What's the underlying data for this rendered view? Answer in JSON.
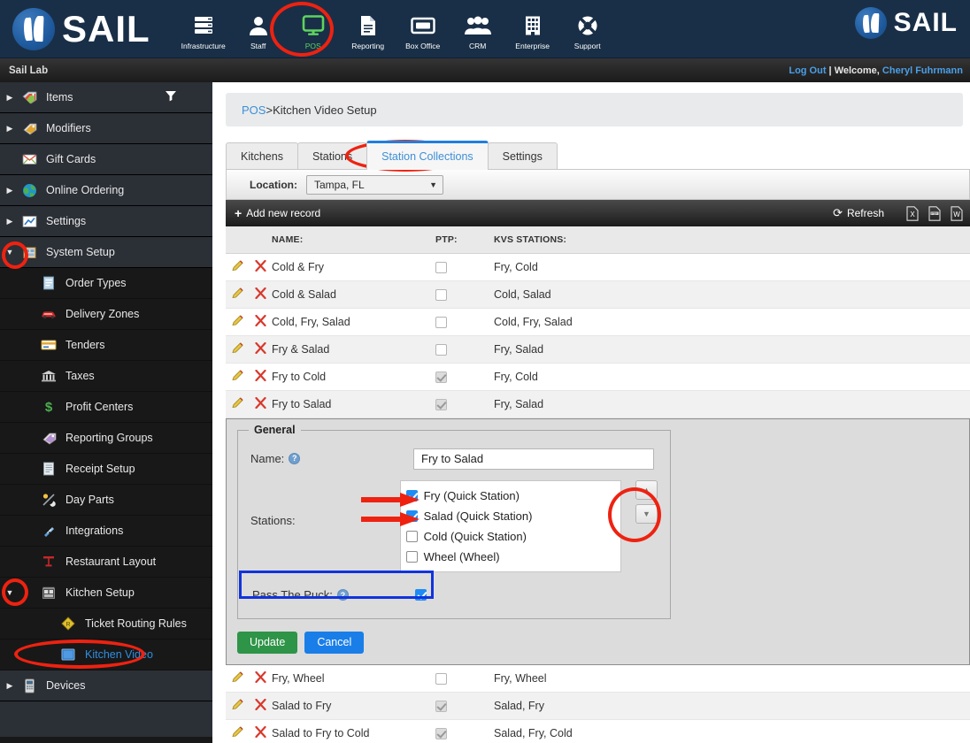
{
  "header": {
    "brand": "SAIL",
    "nav": [
      {
        "label": "Infrastructure",
        "icon": "server-icon",
        "active": false
      },
      {
        "label": "Staff",
        "icon": "user-icon",
        "active": false
      },
      {
        "label": "POS",
        "icon": "monitor-icon",
        "active": true
      },
      {
        "label": "Reporting",
        "icon": "document-icon",
        "active": false
      },
      {
        "label": "Box Office",
        "icon": "ticket-icon",
        "active": false
      },
      {
        "label": "CRM",
        "icon": "people-icon",
        "active": false
      },
      {
        "label": "Enterprise",
        "icon": "building-icon",
        "active": false
      },
      {
        "label": "Support",
        "icon": "lifering-icon",
        "active": false
      }
    ]
  },
  "subbar": {
    "site": "Sail Lab",
    "logout": "Log Out",
    "separator": " | ",
    "welcome": "Welcome, ",
    "user": "Cheryl Fuhrmann"
  },
  "sidebar": {
    "items": [
      {
        "label": "Items",
        "icon": "tags-icon",
        "level": 1,
        "caret": "right",
        "filter": true,
        "selected": false
      },
      {
        "label": "Modifiers",
        "icon": "tag-icon",
        "level": 1,
        "caret": "right",
        "filter": false,
        "selected": false
      },
      {
        "label": "Gift Cards",
        "icon": "giftcard-icon",
        "level": 1,
        "caret": "none",
        "filter": false,
        "selected": false
      },
      {
        "label": "Online Ordering",
        "icon": "globe-icon",
        "level": 1,
        "caret": "right",
        "filter": false,
        "selected": false
      },
      {
        "label": "Settings",
        "icon": "chart-icon",
        "level": 1,
        "caret": "right",
        "filter": false,
        "selected": false
      },
      {
        "label": "System Setup",
        "icon": "setup-icon",
        "level": 1,
        "caret": "down",
        "filter": false,
        "selected": false
      },
      {
        "label": "Order Types",
        "icon": "list-icon",
        "level": 2,
        "caret": "none",
        "filter": false,
        "selected": false
      },
      {
        "label": "Delivery Zones",
        "icon": "car-icon",
        "level": 2,
        "caret": "none",
        "filter": false,
        "selected": false
      },
      {
        "label": "Tenders",
        "icon": "creditcard-icon",
        "level": 2,
        "caret": "none",
        "filter": false,
        "selected": false
      },
      {
        "label": "Taxes",
        "icon": "bank-icon",
        "level": 2,
        "caret": "none",
        "filter": false,
        "selected": false
      },
      {
        "label": "Profit Centers",
        "icon": "dollar-icon",
        "level": 2,
        "caret": "none",
        "filter": false,
        "selected": false
      },
      {
        "label": "Reporting Groups",
        "icon": "tag-icon",
        "level": 2,
        "caret": "none",
        "filter": false,
        "selected": false
      },
      {
        "label": "Receipt Setup",
        "icon": "receipt-icon",
        "level": 2,
        "caret": "none",
        "filter": false,
        "selected": false
      },
      {
        "label": "Day Parts",
        "icon": "daynight-icon",
        "level": 2,
        "caret": "none",
        "filter": false,
        "selected": false
      },
      {
        "label": "Integrations",
        "icon": "plug-icon",
        "level": 2,
        "caret": "none",
        "filter": false,
        "selected": false
      },
      {
        "label": "Restaurant Layout",
        "icon": "table-icon",
        "level": 2,
        "caret": "none",
        "filter": false,
        "selected": false
      },
      {
        "label": "Kitchen Setup",
        "icon": "kitchen-icon",
        "level": 2,
        "caret": "down",
        "filter": false,
        "selected": false
      },
      {
        "label": "Ticket Routing Rules",
        "icon": "routing-icon",
        "level": 3,
        "caret": "none",
        "filter": false,
        "selected": false
      },
      {
        "label": "Kitchen Video",
        "icon": "video-icon",
        "level": 3,
        "caret": "none",
        "filter": false,
        "selected": true
      },
      {
        "label": "Devices",
        "icon": "device-icon",
        "level": 1,
        "caret": "right",
        "filter": false,
        "selected": false
      }
    ]
  },
  "breadcrumb": {
    "root": "POS",
    "sep": " > ",
    "current": "Kitchen Video Setup"
  },
  "tabs": [
    {
      "label": "Kitchens",
      "active": false
    },
    {
      "label": "Stations",
      "active": false
    },
    {
      "label": "Station Collections",
      "active": true
    },
    {
      "label": "Settings",
      "active": false
    }
  ],
  "location": {
    "label": "Location:",
    "value": "Tampa, FL",
    "options": [
      "Tampa, FL"
    ]
  },
  "gridbar": {
    "add_label": "Add new record",
    "refresh_label": "Refresh",
    "exports": [
      {
        "name": "excel-export-icon",
        "glyph": "X"
      },
      {
        "name": "pdf-export-icon",
        "glyph": "PDF"
      },
      {
        "name": "word-export-icon",
        "glyph": "W"
      }
    ]
  },
  "table": {
    "columns": [
      "",
      "",
      "NAME:",
      "PTP:",
      "KVS STATIONS:"
    ],
    "rows_top": [
      {
        "name": "Cold & Fry",
        "ptp": false,
        "stations": "Fry, Cold"
      },
      {
        "name": "Cold & Salad",
        "ptp": false,
        "stations": "Cold, Salad"
      },
      {
        "name": "Cold, Fry, Salad",
        "ptp": false,
        "stations": "Cold, Fry, Salad"
      },
      {
        "name": "Fry & Salad",
        "ptp": false,
        "stations": "Fry, Salad"
      },
      {
        "name": "Fry to Cold",
        "ptp": true,
        "stations": "Fry, Cold"
      },
      {
        "name": "Fry to Salad",
        "ptp": true,
        "stations": "Fry, Salad"
      }
    ],
    "rows_bottom": [
      {
        "name": "Fry, Wheel",
        "ptp": false,
        "stations": "Fry, Wheel"
      },
      {
        "name": "Salad to Fry",
        "ptp": true,
        "stations": "Salad, Fry"
      },
      {
        "name": "Salad to Fry to Cold",
        "ptp": true,
        "stations": "Salad, Fry, Cold"
      }
    ]
  },
  "edit_form": {
    "legend": "General",
    "name_label": "Name:",
    "name_value": "Fry to Salad",
    "name_placeholder": "",
    "stations_label": "Stations:",
    "stations": [
      {
        "label": "Fry (Quick Station)",
        "checked": true
      },
      {
        "label": "Salad (Quick Station)",
        "checked": true
      },
      {
        "label": "Cold (Quick Station)",
        "checked": false
      },
      {
        "label": "Wheel (Wheel)",
        "checked": false
      }
    ],
    "ptp_label": "Pass The Puck:",
    "ptp_checked": true,
    "update_label": "Update",
    "cancel_label": "Cancel",
    "help_glyph": "?"
  },
  "colors": {
    "header_bg": "#192f47",
    "accent_blue": "#3d8fd6",
    "annotation_red": "#ee2211",
    "annotation_blue": "#1133dd",
    "update_green": "#2e9447",
    "cancel_blue": "#1a7ee8",
    "active_nav_green": "#5fd35f"
  }
}
